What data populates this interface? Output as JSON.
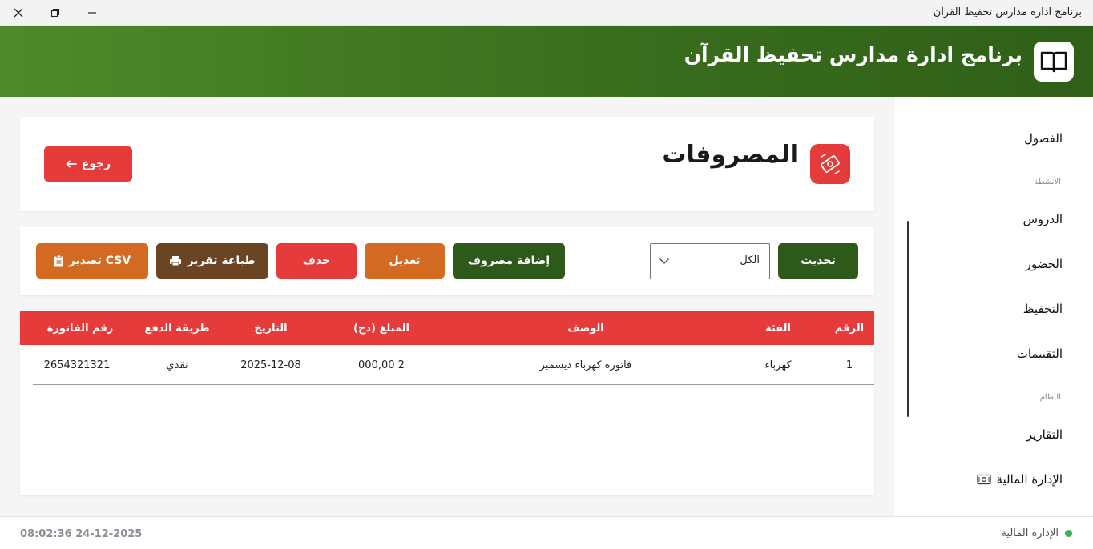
{
  "window": {
    "title": "برنامج ادارة مدارس تحفيظ القرآن"
  },
  "header": {
    "title": "برنامج ادارة مدارس تحفيظ القرآن",
    "logo_icon": "book-icon"
  },
  "sidebar": {
    "items": [
      {
        "label": "الفصول"
      },
      {
        "label": "الدروس"
      },
      {
        "label": "الحضور"
      },
      {
        "label": "التحفيظ"
      },
      {
        "label": "التقييمات"
      },
      {
        "label": "التقارير"
      },
      {
        "label": "الإدارة المالية"
      }
    ],
    "sections": {
      "activities": "الأنشطة",
      "system": "النظام"
    }
  },
  "page": {
    "title": "المصروفات",
    "icon": "money-wings-icon",
    "back_label": "رجوع"
  },
  "toolbar": {
    "refresh_label": "تحديث",
    "filter_value": "الكل",
    "add_label": "إضافة مصروف",
    "edit_label": "تعديل",
    "delete_label": "حذف",
    "print_label": "طباعة تقرير",
    "export_label": "CSV تصدير"
  },
  "table": {
    "columns": [
      "الرقم",
      "الفئة",
      "الوصف",
      "المبلغ (دج)",
      "التاريخ",
      "طريقة الدفع",
      "رقم الفاتورة"
    ],
    "rows": [
      [
        "1",
        "كهرباء",
        "فاتورة كهرباء ديسمبر",
        "2 000,00",
        "2025-12-08",
        "نقدي",
        "2654321321"
      ]
    ]
  },
  "statusbar": {
    "datetime": "08:02:36 24-12-2025",
    "current_section": "الإدارة المالية",
    "status_color": "#3fb34f"
  },
  "colors": {
    "header_green": "#3a6e1e",
    "dark_green": "#2d5a1b",
    "red": "#e63b3b",
    "orange": "#d26a21",
    "brown": "#6b4424"
  }
}
